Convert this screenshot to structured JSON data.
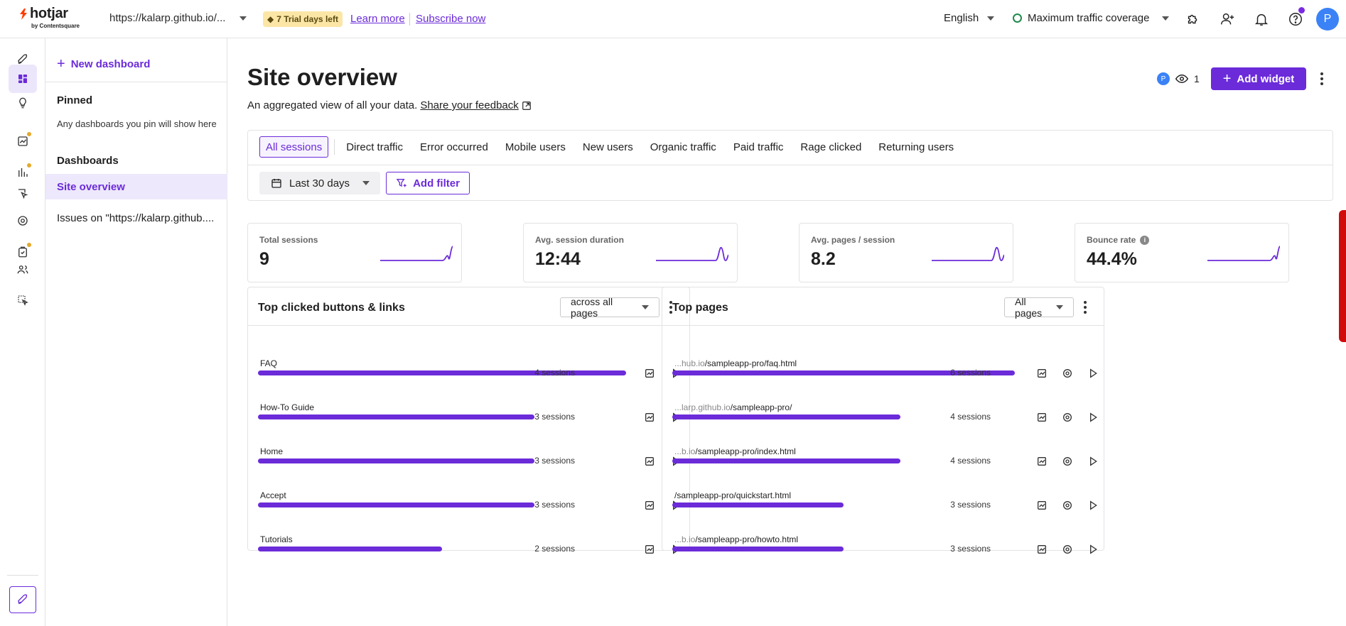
{
  "topbar": {
    "logo_word": "hotjar",
    "logo_sub": "by Contentsquare",
    "site_url": "https://kalarp.github.io/...",
    "trial_badge": "7 Trial days left",
    "learn_more": "Learn more",
    "subscribe": "Subscribe now",
    "language": "English",
    "traffic": "Maximum traffic coverage",
    "avatar_initial": "P"
  },
  "nav": {
    "new_dashboard": "New dashboard",
    "pinned_heading": "Pinned",
    "pinned_note": "Any dashboards you pin will show here",
    "dashboards_heading": "Dashboards",
    "items": [
      "Site overview",
      "Issues on \"https://kalarp.github...."
    ]
  },
  "main": {
    "title": "Site overview",
    "subtitle": "An aggregated view of all your data.",
    "feedback_link": "Share your feedback",
    "viewer_initial": "P",
    "viewer_count": "1",
    "add_widget": "Add widget",
    "segments": [
      "All sessions",
      "Direct traffic",
      "Error occurred",
      "Mobile users",
      "New users",
      "Organic traffic",
      "Paid traffic",
      "Rage clicked",
      "Returning users"
    ],
    "date_range": "Last 30 days",
    "add_filter": "Add filter"
  },
  "kpis": [
    {
      "label": "Total sessions",
      "value": "9"
    },
    {
      "label": "Avg. session duration",
      "value": "12:44"
    },
    {
      "label": "Avg. pages / session",
      "value": "8.2"
    },
    {
      "label": "Bounce rate",
      "value": "44.4%"
    }
  ],
  "clicked_card": {
    "title": "Top clicked buttons & links",
    "filter": "across all pages",
    "rows": [
      {
        "label": "FAQ",
        "count": "4 sessions",
        "fill": 1.0
      },
      {
        "label": "How-To Guide",
        "count": "3 sessions",
        "fill": 0.75
      },
      {
        "label": "Home",
        "count": "3 sessions",
        "fill": 0.75
      },
      {
        "label": "Accept",
        "count": "3 sessions",
        "fill": 0.75
      },
      {
        "label": "Tutorials",
        "count": "2 sessions",
        "fill": 0.5
      }
    ]
  },
  "pages_card": {
    "title": "Top pages",
    "filter": "All pages",
    "rows": [
      {
        "prefix": "...hub.io",
        "path": "/sampleapp-pro/faq.html",
        "count": "6 sessions",
        "fill": 1.0
      },
      {
        "prefix": "...larp.github.io",
        "path": "/sampleapp-pro/",
        "count": "4 sessions",
        "fill": 0.667
      },
      {
        "prefix": "...b.io",
        "path": "/sampleapp-pro/index.html",
        "count": "4 sessions",
        "fill": 0.667
      },
      {
        "prefix": "",
        "path": "/sampleapp-pro/quickstart.html",
        "count": "3 sessions",
        "fill": 0.5
      },
      {
        "prefix": "...b.io",
        "path": "/sampleapp-pro/howto.html",
        "count": "3 sessions",
        "fill": 0.5
      }
    ]
  },
  "colors": {
    "accent": "#6b2bd9",
    "badge": "#fbe6a6",
    "traffic_ring": "#1f8a4d",
    "alert_strip": "#d10a0a"
  }
}
